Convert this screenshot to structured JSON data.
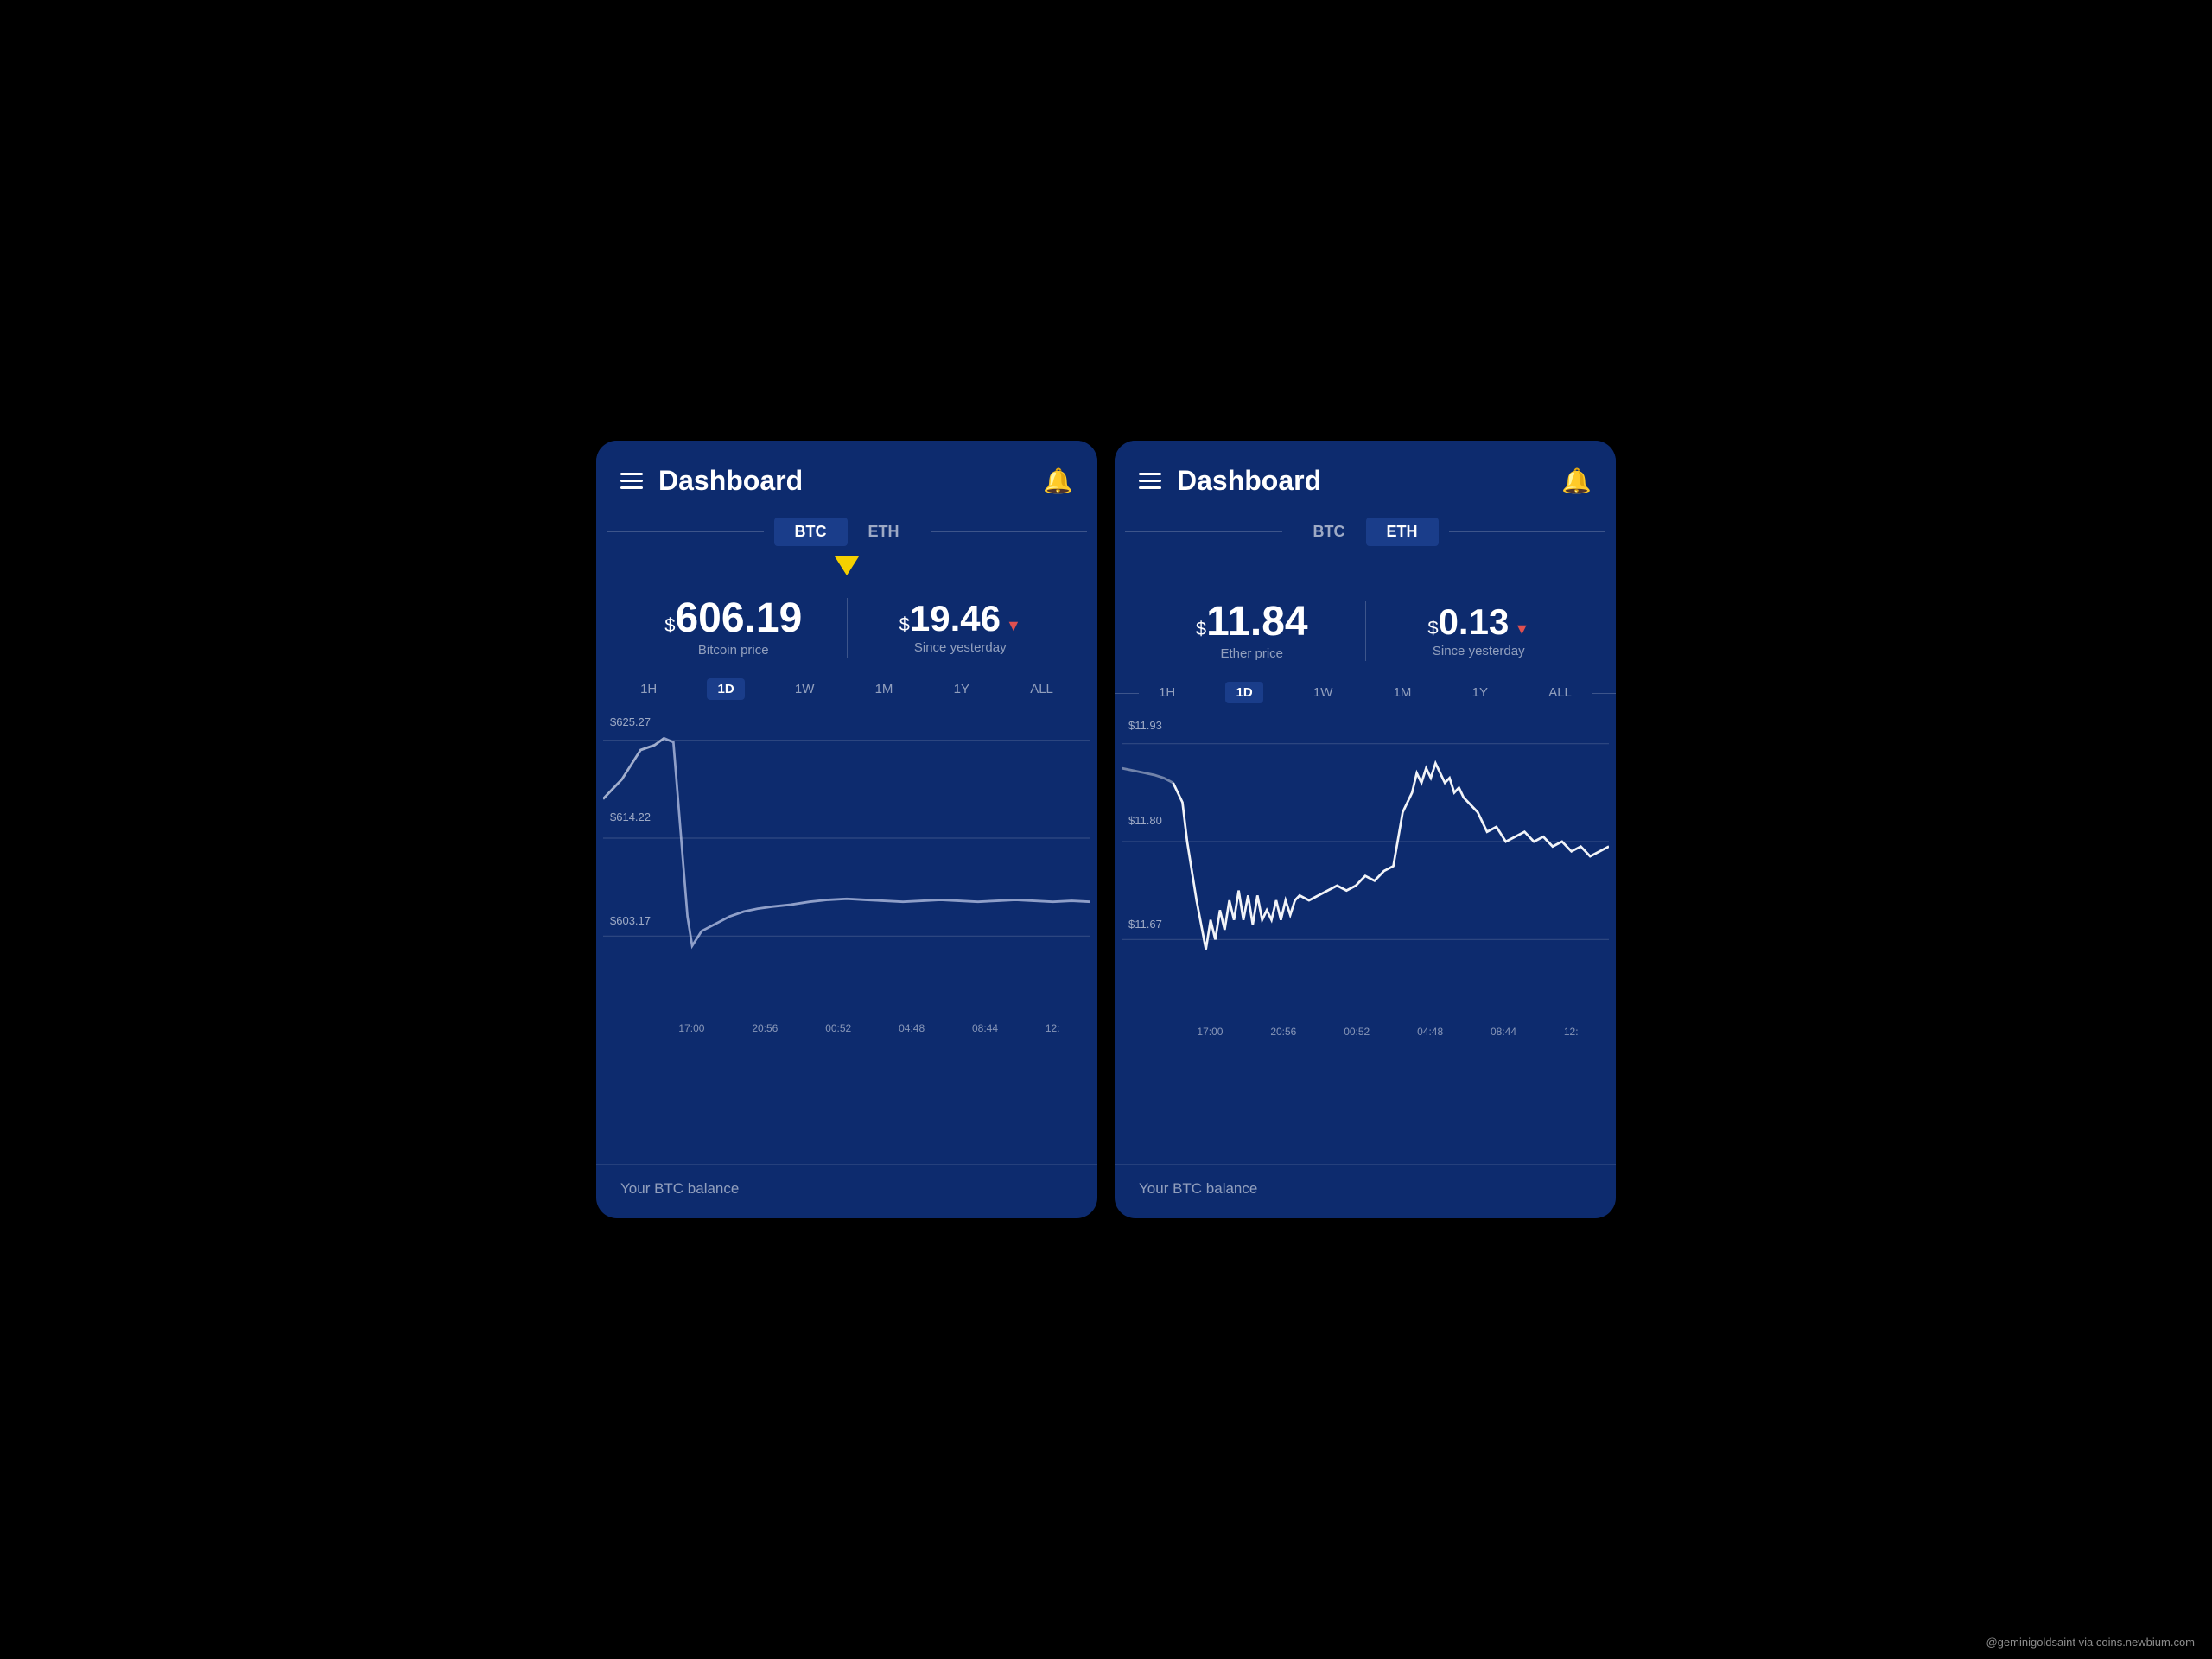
{
  "left_panel": {
    "title": "Dashboard",
    "tabs": [
      "BTC",
      "ETH"
    ],
    "active_tab": "BTC",
    "price_main": "606.19",
    "price_label": "Bitcoin price",
    "price_change": "19.46",
    "price_change_label": "Since yesterday",
    "timeframes": [
      "1H",
      "1D",
      "1W",
      "1M",
      "1Y",
      "ALL"
    ],
    "active_timeframe": "1D",
    "chart_labels": {
      "y1": "$625.27",
      "y2": "$614.22",
      "y3": "$603.17"
    },
    "chart_x": [
      "17:00",
      "20:56",
      "00:52",
      "04:48",
      "08:44",
      "12:"
    ],
    "balance_label": "Your BTC balance",
    "has_arrow": true
  },
  "right_panel": {
    "title": "Dashboard",
    "tabs": [
      "BTC",
      "ETH"
    ],
    "active_tab": "ETH",
    "price_main": "11.84",
    "price_label": "Ether price",
    "price_change": "0.13",
    "price_change_label": "Since yesterday",
    "timeframes": [
      "1H",
      "1D",
      "1W",
      "1M",
      "1Y",
      "ALL"
    ],
    "active_timeframe": "1D",
    "chart_labels": {
      "y1": "$11.93",
      "y2": "$11.80",
      "y3": "$11.67"
    },
    "chart_x": [
      "17:00",
      "20:56",
      "00:52",
      "04:48",
      "08:44",
      "12:"
    ],
    "balance_label": "Your BTC balance",
    "has_arrow": false
  },
  "watermark": "@geminigoldsaint via coins.newbium.com"
}
